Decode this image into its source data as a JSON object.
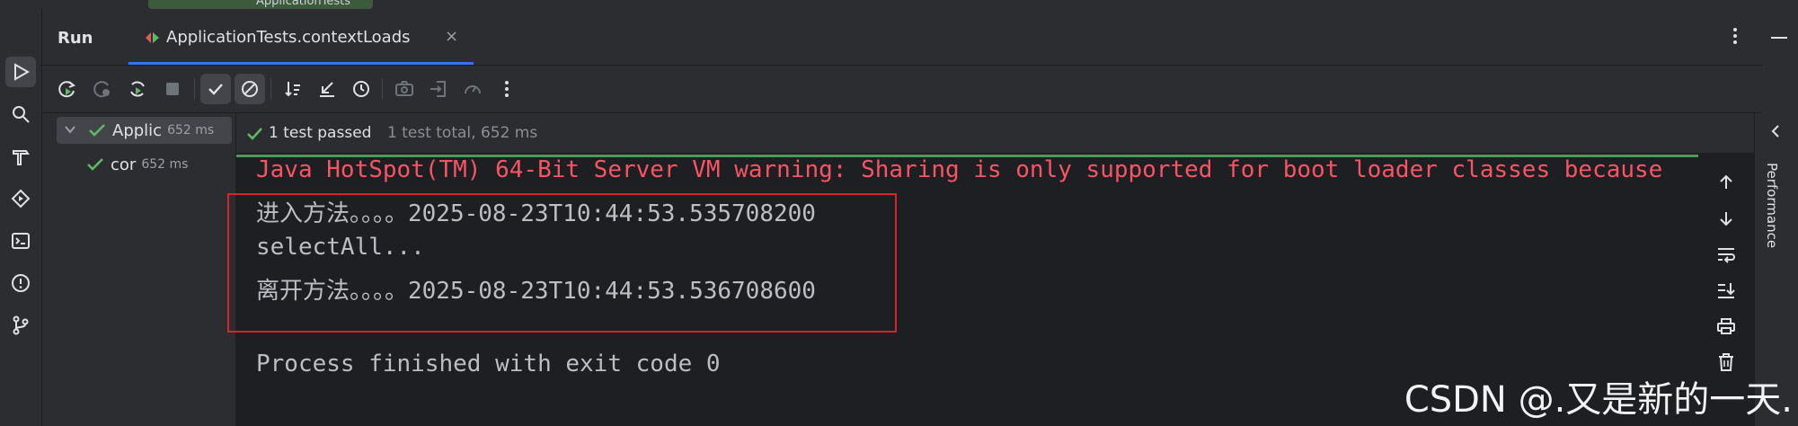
{
  "top_fragment": "ApplicationTests",
  "run_panel": {
    "label": "Run",
    "tab_title": "ApplicationTests.contextLoads",
    "tab_close": "×"
  },
  "tree": {
    "items": [
      {
        "label": "Applic",
        "time": "652 ms"
      },
      {
        "label": "cor",
        "time": "652 ms"
      }
    ]
  },
  "status": {
    "main": "1 test passed",
    "sub": "1 test total, 652 ms"
  },
  "console": {
    "lines": [
      "Java HotSpot(TM) 64-Bit Server VM warning: Sharing is only supported for boot loader classes because",
      "进入方法。。。。2025-08-23T10:44:53.535708200",
      "selectAll...",
      "离开方法。。。。2025-08-23T10:44:53.536708600",
      "Process finished with exit code 0"
    ]
  },
  "right_panel": {
    "label": "Performance"
  },
  "watermark": "CSDN @.又是新的一天.",
  "colors": {
    "accent": "#3574f0",
    "pass": "#499c54",
    "warning": "#f75464",
    "highlight_box": "#d8232a"
  }
}
